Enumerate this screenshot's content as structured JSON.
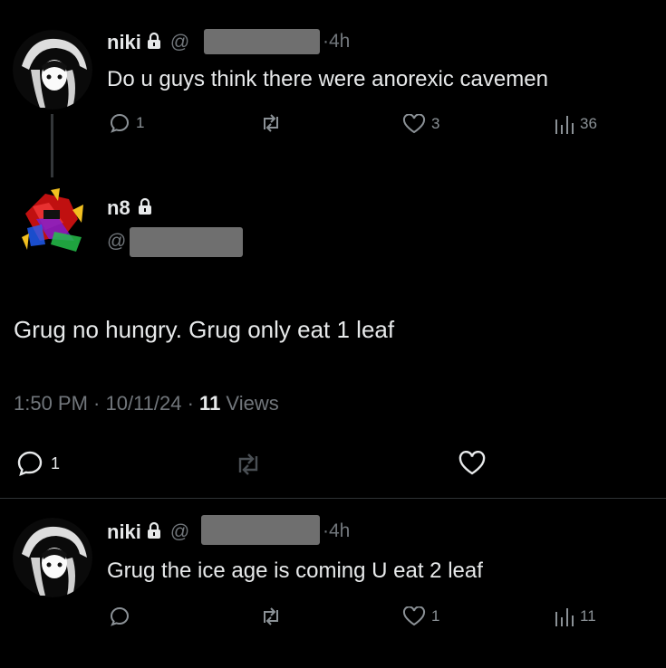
{
  "tweet1": {
    "name": "niki",
    "handle_prefix": "@",
    "time": "·4h",
    "text": "Do u guys think there were anorexic cavemen",
    "reply_count": "1",
    "like_count": "3",
    "view_count": "36"
  },
  "main_tweet": {
    "name": "n8",
    "handle_prefix": "@",
    "text": "Grug no hungry. Grug only eat 1 leaf",
    "meta_time": "1:50 PM · 10/11/24 · ",
    "meta_views_count": "11",
    "meta_views_label": " Views",
    "reply_count": "1"
  },
  "tweet3": {
    "name": "niki",
    "handle_prefix": "@",
    "time": "·4h",
    "text": "Grug the ice age is coming U eat 2 leaf",
    "like_count": "1",
    "view_count": "11"
  },
  "icons": {
    "reply": "reply-icon",
    "retweet": "retweet-icon",
    "like": "heart-icon",
    "views": "views-icon",
    "lock": "lock-icon"
  },
  "colors": {
    "background": "#000000",
    "text": "#e7e9ea",
    "muted": "#71767b",
    "redaction": "#6f6f6f"
  }
}
